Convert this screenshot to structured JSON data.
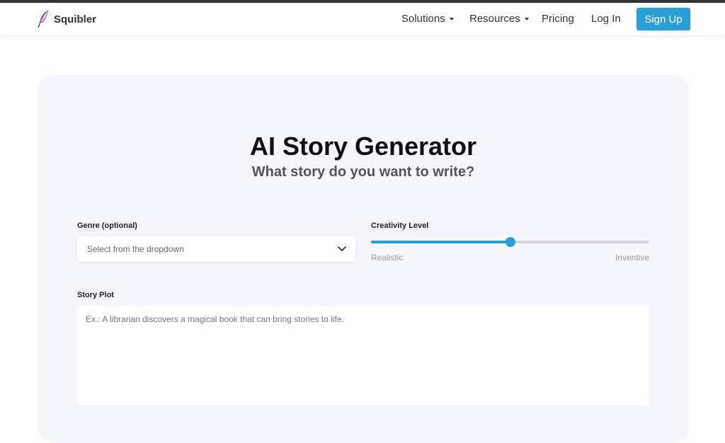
{
  "colors": {
    "accent": "#2a9fd6",
    "card_background": "#f6f6fd",
    "top_strip": "#333333"
  },
  "nav": {
    "brand": "Squibler",
    "logo_icon": "quill-feather-icon",
    "items": [
      {
        "label": "Solutions",
        "has_caret": true
      },
      {
        "label": "Resources",
        "has_caret": true
      },
      {
        "label": "Pricing",
        "has_caret": false
      },
      {
        "label": "Log In",
        "has_caret": false
      }
    ],
    "signup_label": "Sign Up"
  },
  "hero": {
    "title": "AI Story Generator",
    "subtitle": "What story do you want to write?"
  },
  "form": {
    "genre": {
      "label": "Genre (optional)",
      "placeholder": "Select from the dropdown",
      "icon": "chevron-down-icon"
    },
    "creativity": {
      "label": "Creativity Level",
      "value": 0.5,
      "min_label": "Realistic",
      "max_label": "Inventive"
    },
    "plot": {
      "label": "Story Plot",
      "placeholder": "Ex.: A librarian discovers a magical book that can bring stories to life."
    }
  }
}
